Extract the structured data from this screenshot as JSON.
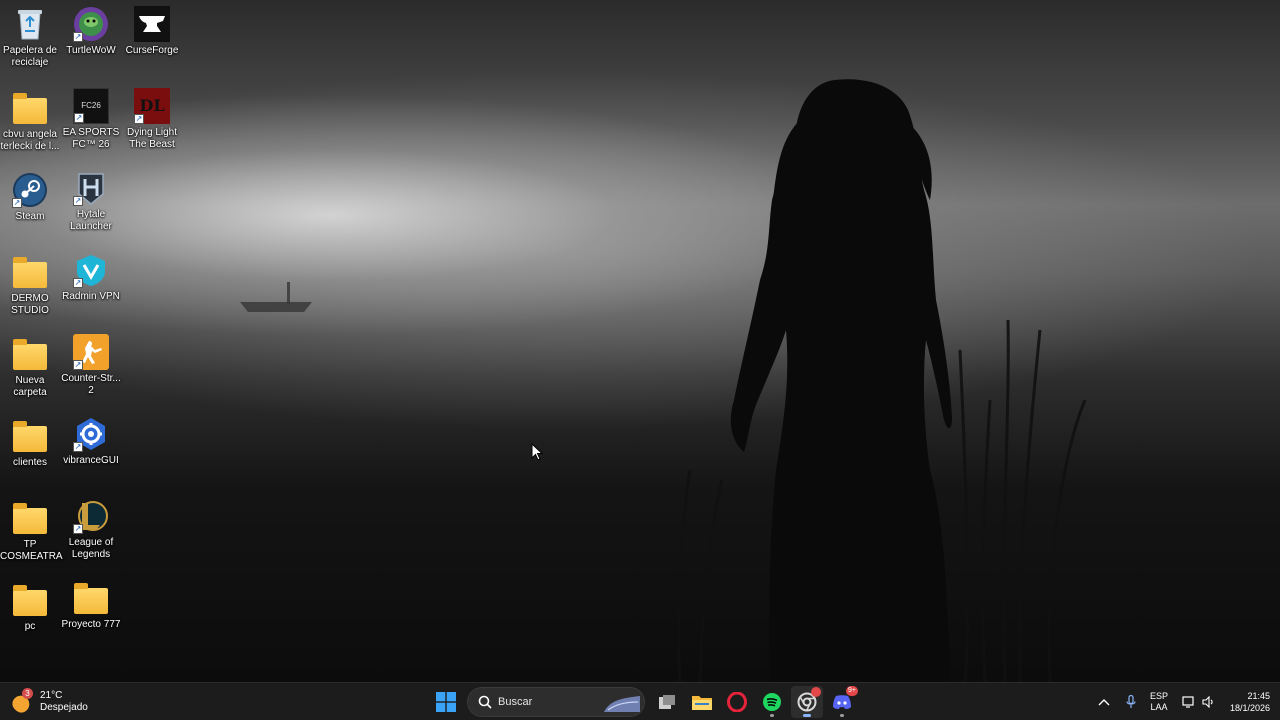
{
  "desktop": {
    "icons": [
      {
        "label": "Papelera de reciclaje",
        "icon": "recycle-bin-icon"
      },
      {
        "label": "TurtleWoW",
        "icon": "turtlewow-icon"
      },
      {
        "label": "CurseForge",
        "icon": "curseforge-icon"
      },
      {
        "label": "cbvu angela terlecki de l...",
        "icon": "folder-icon"
      },
      {
        "label": "EA SPORTS FC™ 26",
        "icon": "ea-sports-fc-icon"
      },
      {
        "label": "Dying Light The Beast",
        "icon": "dying-light-icon"
      },
      {
        "label": "Steam",
        "icon": "steam-icon"
      },
      {
        "label": "Hytale Launcher",
        "icon": "hytale-icon"
      },
      {
        "label": "DERMO STUDIO",
        "icon": "folder-icon"
      },
      {
        "label": "Radmin VPN",
        "icon": "radmin-vpn-icon"
      },
      {
        "label": "Nueva carpeta",
        "icon": "folder-icon"
      },
      {
        "label": "Counter-Str... 2",
        "icon": "counter-strike-icon"
      },
      {
        "label": "clientes",
        "icon": "folder-icon"
      },
      {
        "label": "vibranceGUI",
        "icon": "vibrancegui-icon"
      },
      {
        "label": "TP COSMEATRA",
        "icon": "folder-icon"
      },
      {
        "label": "League of Legends",
        "icon": "league-of-legends-icon"
      },
      {
        "label": "pc",
        "icon": "folder-icon"
      },
      {
        "label": "Proyecto 777",
        "icon": "folder-icon"
      }
    ],
    "ea_logo_text": "FC26",
    "dl_logo_text": "DL"
  },
  "taskbar": {
    "weather": {
      "temp": "21°C",
      "condition": "Despejado",
      "badge": "3"
    },
    "search": {
      "placeholder": "Buscar"
    },
    "apps": [
      "start-icon",
      "task-view-icon",
      "file-explorer-icon",
      "opera-icon",
      "spotify-icon",
      "chrome-icon",
      "discord-icon"
    ],
    "discord_badge": "9+",
    "tray": {
      "lang": "ESP",
      "layout": "LAA",
      "time": "21:45",
      "date": "18/1/2026"
    }
  },
  "colors": {
    "taskbar_bg": "#1c1c1c",
    "accent": "#8ab4f8",
    "folder": "#f4b93a"
  }
}
